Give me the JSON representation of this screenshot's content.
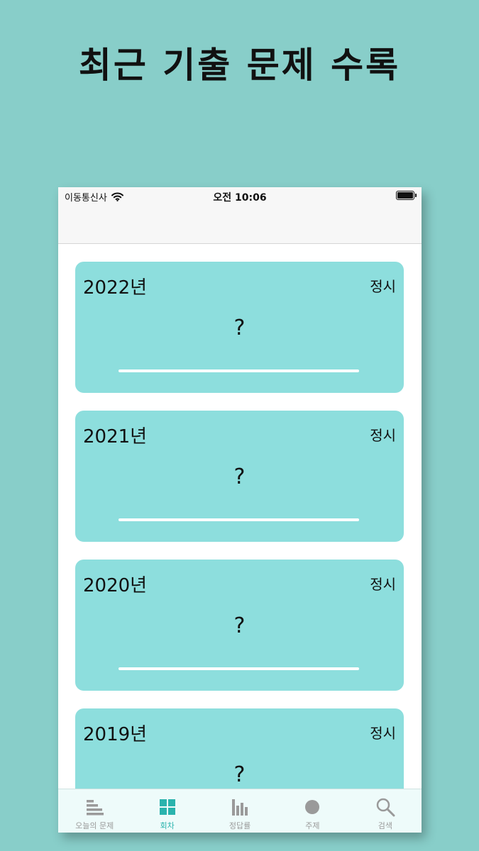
{
  "headline": "최근 기출 문제 수록",
  "status": {
    "carrier": "이동통신사",
    "time": "오전 10:06"
  },
  "cards": [
    {
      "year": "2022년",
      "kind": "정시",
      "score": "?"
    },
    {
      "year": "2021년",
      "kind": "정시",
      "score": "?"
    },
    {
      "year": "2020년",
      "kind": "정시",
      "score": "?"
    },
    {
      "year": "2019년",
      "kind": "정시",
      "score": "?"
    }
  ],
  "tabs": [
    {
      "label": "오늘의 문제",
      "icon": "list-icon"
    },
    {
      "label": "회차",
      "icon": "grid-icon",
      "active": true
    },
    {
      "label": "정답률",
      "icon": "bar-chart-icon"
    },
    {
      "label": "주제",
      "icon": "circle-icon"
    },
    {
      "label": "검색",
      "icon": "search-icon"
    }
  ],
  "colors": {
    "background": "#88cec9",
    "card": "#8ddedd",
    "accent": "#2ab3ad"
  }
}
